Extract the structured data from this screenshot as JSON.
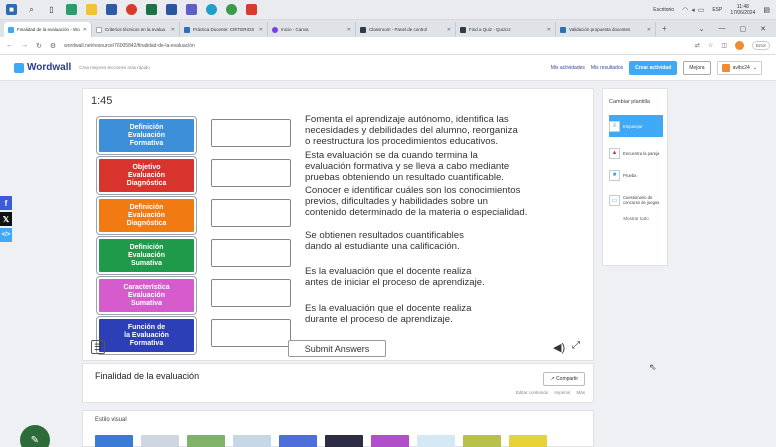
{
  "taskbar": {
    "clock_time": "11:48",
    "clock_date": "17/06/2024",
    "lang": "ESP",
    "notif_label": "Escritorio"
  },
  "browser": {
    "tabs": [
      {
        "label": "Finalidad de la evaluación - Wo",
        "color": "#3fa9f5",
        "active": true
      },
      {
        "label": "Criterios técnicos en la evalua",
        "color": "#ffffff",
        "active": false
      },
      {
        "label": "Práctica Docente: CRITERIOS",
        "color": "#2f6fb8",
        "active": false
      },
      {
        "label": "Inicio - Canva",
        "color": "#7d3cf2",
        "active": false
      },
      {
        "label": "Classroom - Panel de control",
        "color": "#2f3a4a",
        "active": false
      },
      {
        "label": "Find a Quiz - Quizizz",
        "color": "#2f3a4a",
        "active": false
      },
      {
        "label": "Validación propuesta docentes",
        "color": "#2f6fb8",
        "active": false
      }
    ],
    "url": "wordwall.net/resource/76005842/finalidad-de-la-evaluación",
    "profile_label": "Error"
  },
  "header": {
    "logo": "Wordwall",
    "slogan": "Crea mejores lecciones más rápido",
    "nav": {
      "activities": "Mis actividades",
      "results": "Mis resultados",
      "create": "Crear actividad",
      "upgrade": "Mejora",
      "user": "avibc24"
    }
  },
  "game": {
    "timer": "1:45",
    "labels": [
      {
        "text": "Definición\nEvaluación\nFormativa",
        "color": "#3d8fd9"
      },
      {
        "text": "Objetivo\nEvaluación\nDiagnóstica",
        "color": "#d9332e"
      },
      {
        "text": "Definición\nEvaluación\nDiagnóstica",
        "color": "#f27a13"
      },
      {
        "text": "Definición\nEvaluación\nSumativa",
        "color": "#1f9a4a"
      },
      {
        "text": "Característica\nEvaluación\nSumativa",
        "color": "#d65ccd"
      },
      {
        "text": "Función de\nla Evaluación\nFormativa",
        "color": "#2c3fb6"
      }
    ],
    "definitions": [
      "Fomenta el aprendizaje autónomo, identifica las\nnecesidades y debilidades del alumno, reorganiza\no reestructura los procedimientos educativos.",
      "Esta evaluación se da cuando termina la\nevaluación formativa y se lleva a cabo mediante\npruebas obteniendo un resultado cuantificable.",
      "Conocer e identificar cuáles son los conocimientos\nprevios, dificultades y habilidades sobre un\ncontenido determinado de la materia o especialidad.",
      "Se obtienen resultados cuantificables\ndando al estudiante una calificación.",
      "Es la evaluación que el docente realiza\nantes de iniciar el proceso de aprendizaje.",
      "Es la evaluación que el docente realiza\ndurante el proceso de aprendizaje."
    ],
    "submit": "Submit Answers"
  },
  "activity": {
    "title": "Finalidad de la evaluación",
    "share": "Compartir",
    "links": [
      "Editar contenido",
      "Imprimir",
      "Más"
    ]
  },
  "visual_style": {
    "label": "Estilo visual",
    "thumb_colors": [
      "#3a7bd5",
      "#cfd6e0",
      "#7fb36a",
      "#c6d7e8",
      "#4c6fd9",
      "#2c2c44",
      "#b04fc9",
      "#d5e8f5",
      "#b8c24a",
      "#e8d23a",
      "#6a3a8a"
    ]
  },
  "templates": {
    "title": "Cambiar plantilla",
    "items": [
      {
        "label": "Emparejar",
        "active": true
      },
      {
        "label": "Encuentra la pareja",
        "active": false
      },
      {
        "label": "Prueba",
        "active": false
      },
      {
        "label": "Cuestionario de concurso de juegos",
        "active": false
      }
    ],
    "show_all": "Mostrar todo"
  }
}
